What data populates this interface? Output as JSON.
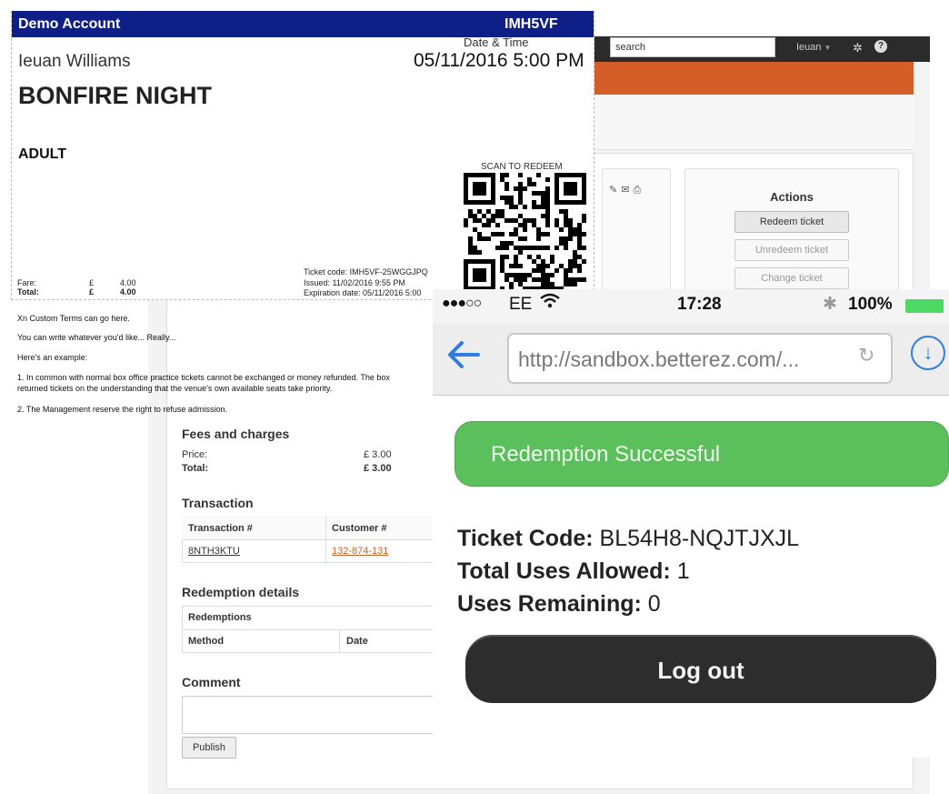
{
  "admin": {
    "search_placeholder": "search",
    "user_name": "Ieuan",
    "actions": {
      "title": "Actions",
      "redeem": "Redeem ticket",
      "unredeem": "Unredeem ticket",
      "change": "Change ticket"
    },
    "fees": {
      "title": "Fees and charges",
      "price_label": "Price:",
      "price_value": "£ 3.00",
      "total_label": "Total:",
      "total_value": "£ 3.00"
    },
    "transaction": {
      "title": "Transaction",
      "headers": [
        "Transaction #",
        "Customer #"
      ],
      "row": [
        "8NTH3KTU",
        "132-874-131"
      ]
    },
    "redemption": {
      "title": "Redemption details",
      "header": "Redemptions",
      "columns": [
        "Method",
        "Date"
      ]
    },
    "comment": {
      "title": "Comment",
      "publish": "Publish"
    },
    "colors": {
      "topbar": "#2b2b2b",
      "orange": "#d45d28",
      "link": "#c4642a"
    }
  },
  "ticket": {
    "account": "Demo Account",
    "reference": "IMH5VF",
    "date_label": "Date & Time",
    "date_value": "05/11/2016 5:00 PM",
    "customer": "Ieuan Williams",
    "event": "BONFIRE NIGHT",
    "ticket_type": "ADULT",
    "scan_label": "SCAN TO REDEEM",
    "fare_label": "Fare:",
    "fare_currency": "£",
    "fare_value": "4.00",
    "total_label": "Total:",
    "total_currency": "£",
    "total_value": "4.00",
    "code_line": "Ticket code: IMH5VF-25WGGJPQ",
    "issued_line": "Issued: 11/02/2016 9:55 PM",
    "expiration_line": "Expiration date: 05/11/2016 5:00",
    "terms": [
      "Xn Custom Terms can go here.",
      "You can write whatever you'd like... Really...",
      "Here's an example:",
      "1. In common with normal box office practice tickets cannot be exchanged or money refunded. The box",
      "returned tickets on the understanding that the venue's own available seats take priority.",
      "2. The Management reserve the right to refuse admission."
    ],
    "header_color": "#0f1f88"
  },
  "phone": {
    "signal": "●●●○○",
    "carrier": "EE",
    "time": "17:28",
    "battery": "100%",
    "battery_level": 1.0,
    "url": "http://sandbox.betterez.com/...",
    "success_message": "Redemption Successful",
    "ticket_code_label": "Ticket Code:",
    "ticket_code_value": "BL54H8-NQJTJXJL",
    "uses_allowed_label": "Total Uses Allowed:",
    "uses_allowed_value": "1",
    "uses_remaining_label": "Uses Remaining:",
    "uses_remaining_value": "0",
    "logout_label": "Log out",
    "colors": {
      "success": "#5bbf5c",
      "link": "#2f7de1",
      "logout": "#2d2d2d"
    }
  }
}
